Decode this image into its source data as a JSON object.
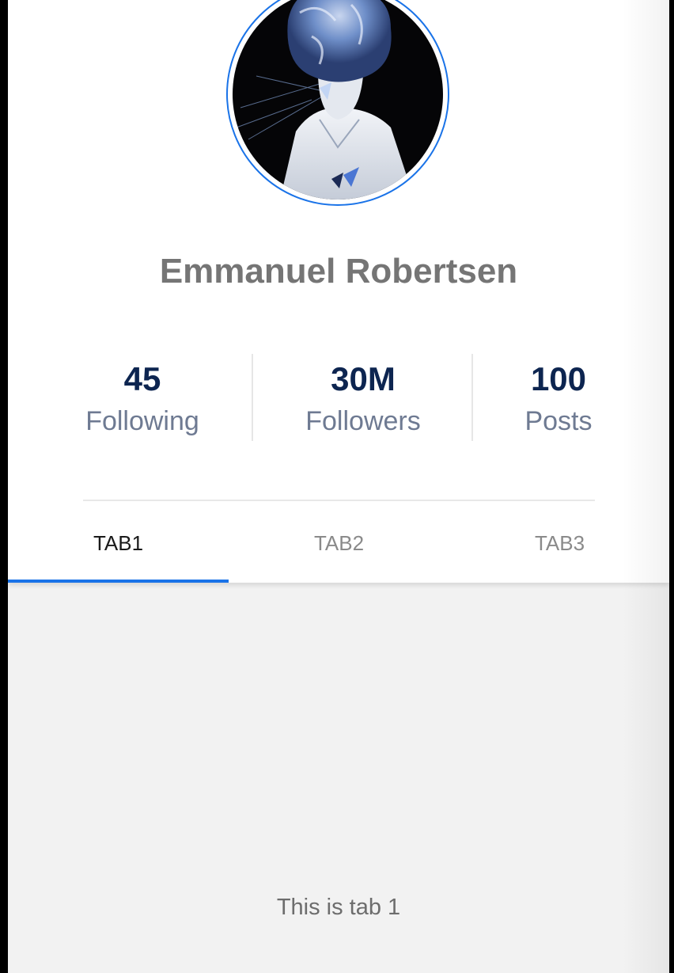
{
  "profile": {
    "name": "Emmanuel Robertsen",
    "avatar": "profile-photo"
  },
  "stats": [
    {
      "value": "45",
      "label": "Following"
    },
    {
      "value": "30M",
      "label": "Followers"
    },
    {
      "value": "100",
      "label": "Posts"
    }
  ],
  "tabs": [
    {
      "label": "TAB1",
      "active": true
    },
    {
      "label": "TAB2",
      "active": false
    },
    {
      "label": "TAB3",
      "active": false
    }
  ],
  "content": {
    "text": "This is tab 1"
  },
  "colors": {
    "accent": "#1a73e8",
    "stat_value": "#0d2550",
    "stat_label": "#6e7a92",
    "name": "#757575",
    "content_bg": "#f2f2f2"
  }
}
